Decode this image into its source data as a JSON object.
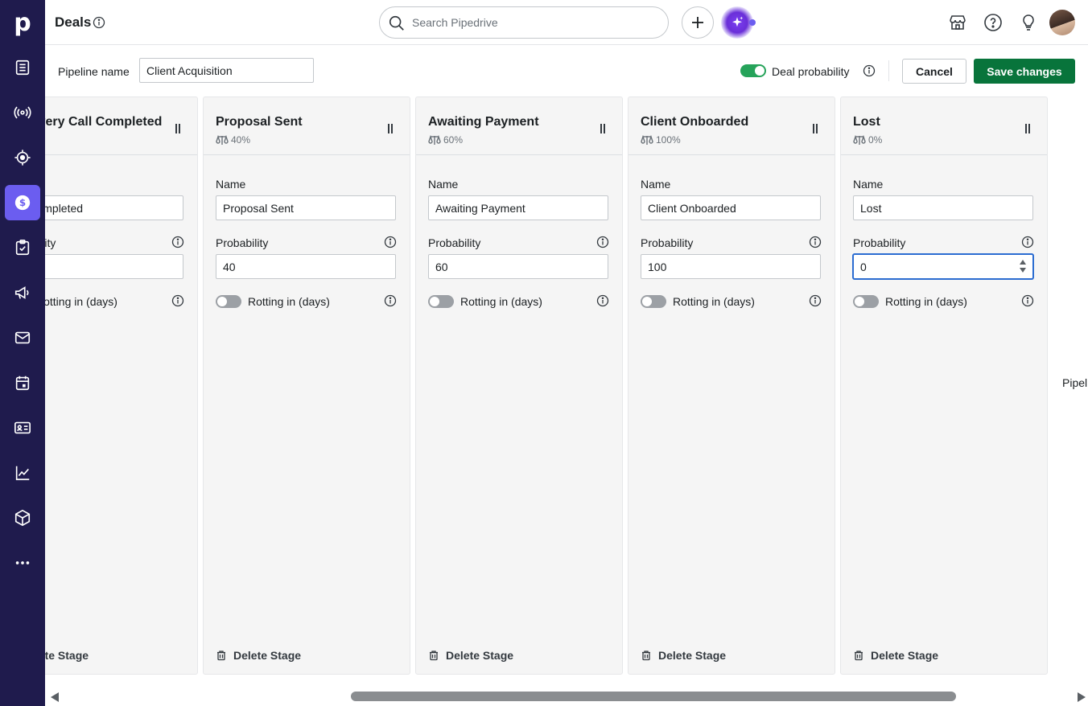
{
  "app": {
    "logo": "p",
    "page_title": "Deals"
  },
  "search": {
    "placeholder": "Search Pipedrive"
  },
  "rail": [
    {
      "icon": "leads-inbox-icon"
    },
    {
      "icon": "radio-signal-icon"
    },
    {
      "icon": "target-icon"
    },
    {
      "icon": "dollar-icon",
      "active": true
    },
    {
      "icon": "task-check-icon"
    },
    {
      "icon": "megaphone-icon"
    },
    {
      "icon": "mail-icon"
    },
    {
      "icon": "calendar-icon"
    },
    {
      "icon": "contacts-card-icon"
    },
    {
      "icon": "chart-icon"
    },
    {
      "icon": "box-icon"
    },
    {
      "icon": "more-icon"
    }
  ],
  "pipeline": {
    "label": "Pipeline name",
    "value": "Client Acquisition",
    "deal_probability_label": "Deal probability",
    "deal_probability_enabled": true,
    "cancel_label": "Cancel",
    "save_label": "Save changes"
  },
  "stage_labels": {
    "name": "Name",
    "probability": "Probability",
    "rotting": "Rotting in (days)",
    "delete": "Delete Stage"
  },
  "stages": [
    {
      "title": "Discovery Call Completed",
      "name": "Discovery Call Completed",
      "probability": ""
    },
    {
      "title": "Proposal Sent",
      "prob_badge": "40%",
      "name": "Proposal Sent",
      "probability": "40"
    },
    {
      "title": "Awaiting Payment",
      "prob_badge": "60%",
      "name": "Awaiting Payment",
      "probability": "60"
    },
    {
      "title": "Client Onboarded",
      "prob_badge": "100%",
      "name": "Client Onboarded",
      "probability": "100"
    },
    {
      "title": "Lost",
      "prob_badge": "0%",
      "name": "Lost",
      "probability": "0"
    }
  ],
  "partial_label": "Pipel",
  "colors": {
    "rail_bg": "#1f1b4d",
    "active_item": "#6b5df0",
    "save_btn": "#08743b",
    "toggle_on": "#26a35a"
  }
}
